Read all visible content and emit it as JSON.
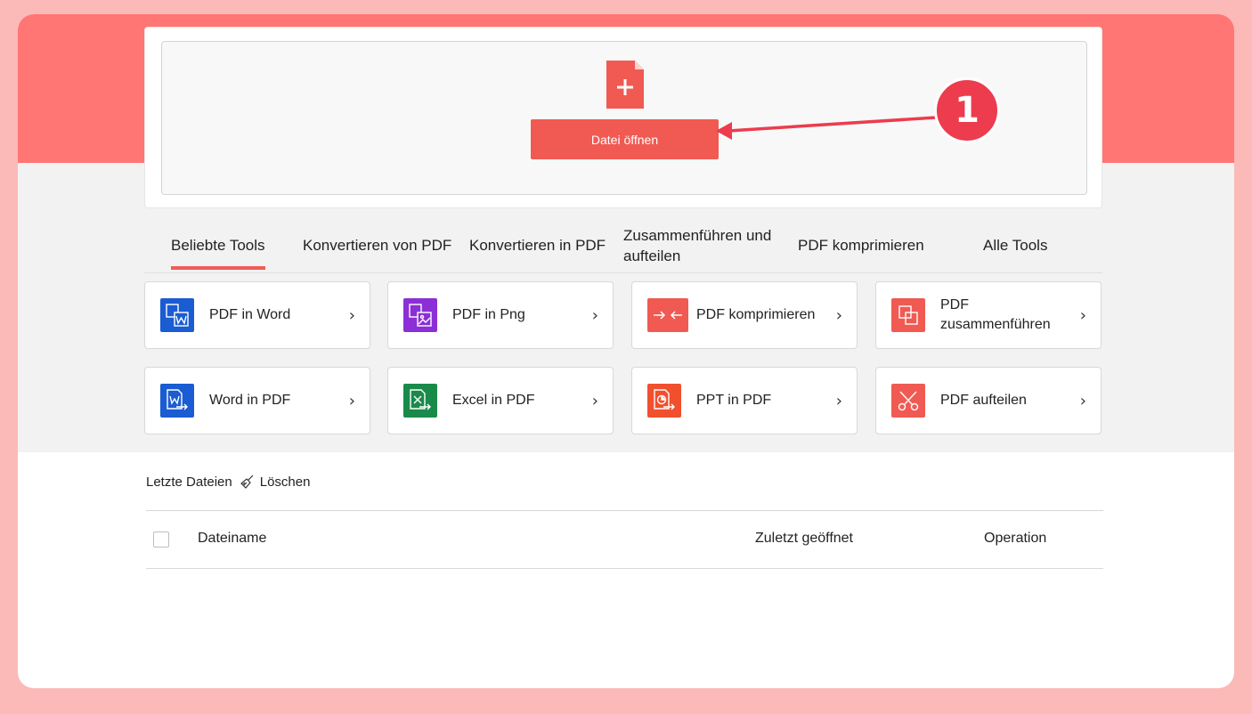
{
  "open_area": {
    "button_label": "Datei öffnen",
    "step_number": "1"
  },
  "tabs": [
    {
      "label": "Beliebte Tools",
      "active": true
    },
    {
      "label": "Konvertieren von PDF",
      "active": false
    },
    {
      "label": "Konvertieren in PDF",
      "active": false
    },
    {
      "label": "Zusammenführen und aufteilen",
      "active": false
    },
    {
      "label": "PDF komprimieren",
      "active": false
    },
    {
      "label": "Alle Tools",
      "active": false
    }
  ],
  "tools": [
    {
      "label": "PDF in Word",
      "icon": "pdf-to-word-icon",
      "color": "#1a5cd1"
    },
    {
      "label": "PDF in Png",
      "icon": "pdf-to-png-icon",
      "color": "#8b2fd6"
    },
    {
      "label": "PDF komprimieren",
      "icon": "compress-icon",
      "color": "#f05a52"
    },
    {
      "label": "PDF zusammenführen",
      "icon": "merge-icon",
      "color": "#f05a52"
    },
    {
      "label": "Word in PDF",
      "icon": "word-to-pdf-icon",
      "color": "#1a5cd1"
    },
    {
      "label": "Excel in PDF",
      "icon": "excel-to-pdf-icon",
      "color": "#1a8a4a"
    },
    {
      "label": "PPT in PDF",
      "icon": "ppt-to-pdf-icon",
      "color": "#f0502e"
    },
    {
      "label": "PDF aufteilen",
      "icon": "split-icon",
      "color": "#f05a52"
    }
  ],
  "recent": {
    "title": "Letzte Dateien",
    "clear_label": "Löschen",
    "columns": {
      "name": "Dateiname",
      "last_opened": "Zuletzt geöffnet",
      "operation": "Operation"
    }
  },
  "colors": {
    "brand": "#ff7674",
    "button": "#f05a52",
    "badge": "#ec3c4e",
    "outer_border": "#fbb9b8"
  }
}
